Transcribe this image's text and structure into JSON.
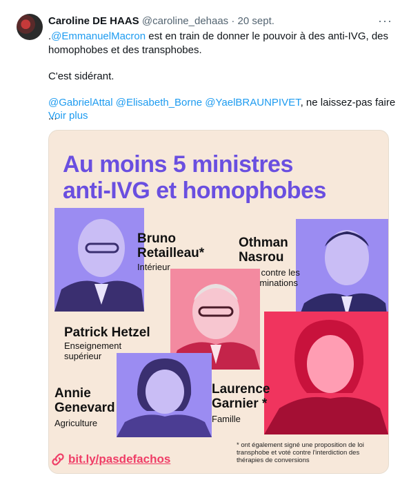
{
  "tweet": {
    "author_name": "Caroline DE HAAS",
    "author_handle": "@caroline_dehaas",
    "separator": "·",
    "date": "20 sept.",
    "more_icon": "more-dots-icon",
    "mention_macron_prefix": ".",
    "mention_macron": "@EmmanuelMacron",
    "line1_rest": " est en train de donner le pouvoir à des anti-IVG, des",
    "line2": "homophobes et des transphobes.",
    "line3": "C'est sidérant.",
    "mention1": "@GabrielAttal",
    "mention2": "@Elisabeth_Borne",
    "mention3": "@YaelBRAUNPIVET",
    "line4_rest": ", ne laissez-pas faire ...",
    "see_more": "Voir plus"
  },
  "card": {
    "headline_line1": "Au moins 5 ministres",
    "headline_line2": "anti-IVG et homophobes",
    "people": [
      {
        "name_line1": "Bruno",
        "name_line2": "Retailleau*",
        "role_line1": "Intérieur",
        "role_line2": ""
      },
      {
        "name_line1": "Othman",
        "name_line2": "Nasrou",
        "role_line1": "Lutte contre les",
        "role_line2": "discriminations"
      },
      {
        "name_line1": "Patrick Hetzel",
        "name_line2": "",
        "role_line1": "Enseignement",
        "role_line2": "supérieur"
      },
      {
        "name_line1": "Annie",
        "name_line2": "Genevard",
        "role_line1": "Agriculture",
        "role_line2": ""
      },
      {
        "name_line1": "Laurence",
        "name_line2": "Garnier *",
        "role_line1": "Famille",
        "role_line2": ""
      }
    ],
    "footnote": "* ont également signé une proposition de loi transphobe et voté contre l'interdiction des thérapies de conversions",
    "footer_link": "bit.ly/pasdefachos",
    "footer_icon": "link-icon"
  },
  "colors": {
    "accent_link": "#1d9bf0",
    "headline": "#6a4fe0",
    "card_bg": "#f7e8da",
    "photo_purple": "#9b8cf2",
    "photo_pink": "#f38aa0",
    "photo_red": "#f0345e",
    "footer_link": "#ef3d66"
  }
}
